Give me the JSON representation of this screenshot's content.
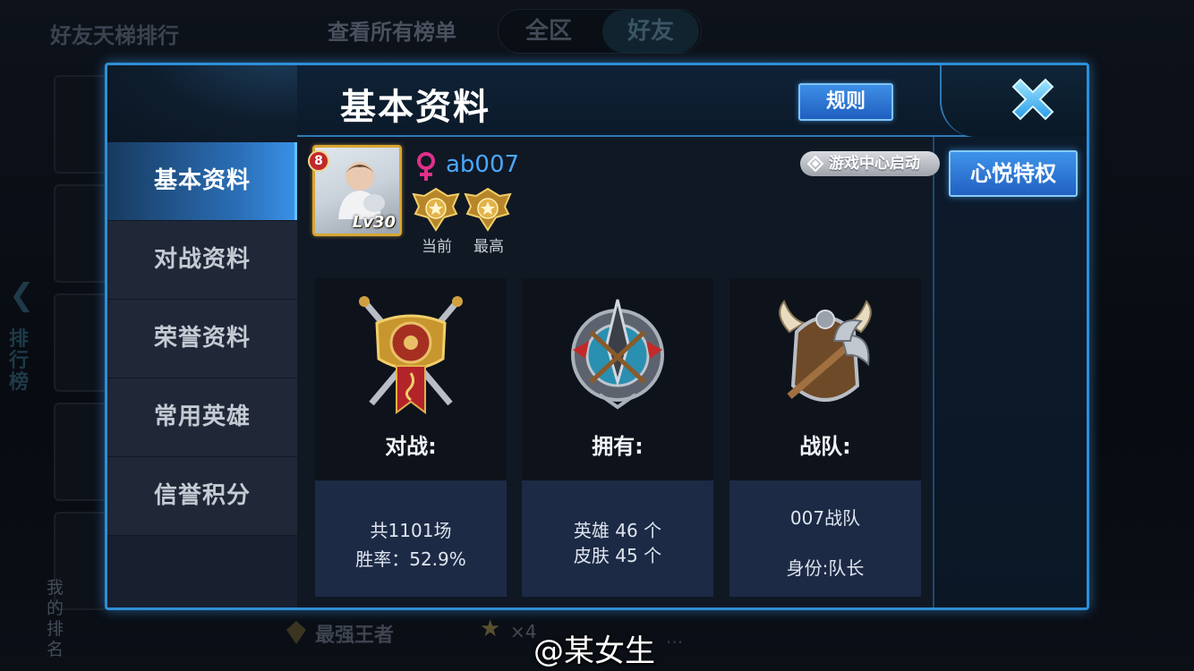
{
  "background": {
    "title": "好友天梯排行",
    "view_all": "查看所有榜单",
    "tabs": [
      "全区",
      "好友"
    ],
    "side_tab": "排行榜",
    "my_rank_label": "我的排名",
    "rank_name": "最强王者",
    "star_count": "×4",
    "ellipsis": "..."
  },
  "dialog": {
    "title": "基本资料",
    "rules_button": "规则",
    "close_icon": "close-x-icon"
  },
  "sidebar": {
    "items": [
      {
        "label": "基本资料",
        "active": true
      },
      {
        "label": "对战资料",
        "active": false
      },
      {
        "label": "荣誉资料",
        "active": false
      },
      {
        "label": "常用英雄",
        "active": false
      },
      {
        "label": "信誉积分",
        "active": false
      }
    ]
  },
  "profile": {
    "vip_level": "8",
    "level": "Lv30",
    "gender_icon": "female-icon",
    "name": "ab007",
    "medals": [
      {
        "label": "当前",
        "icon": "gold-rank-medal-icon"
      },
      {
        "label": "最高",
        "icon": "gold-rank-medal-icon"
      }
    ],
    "game_center_button": "游戏中心启动",
    "privilege_button": "心悦特权"
  },
  "cards": [
    {
      "label": "对战:",
      "icon": "crossed-swords-shield-icon",
      "lines": [
        "共1101场",
        "胜率：52.9%"
      ]
    },
    {
      "label": "拥有:",
      "icon": "spear-emblem-icon",
      "lines": [
        "英雄 46 个",
        "皮肤 45 个"
      ]
    },
    {
      "label": "战队:",
      "icon": "horned-helmet-axe-icon",
      "lines": [
        "007战队",
        "身份:队长"
      ]
    }
  ],
  "watermark": "@某女生",
  "colors": {
    "accent_blue": "#2f8fd6",
    "name_blue": "#4aa8ff",
    "gender_pink": "#e0308a",
    "gold": "#d9a632"
  }
}
